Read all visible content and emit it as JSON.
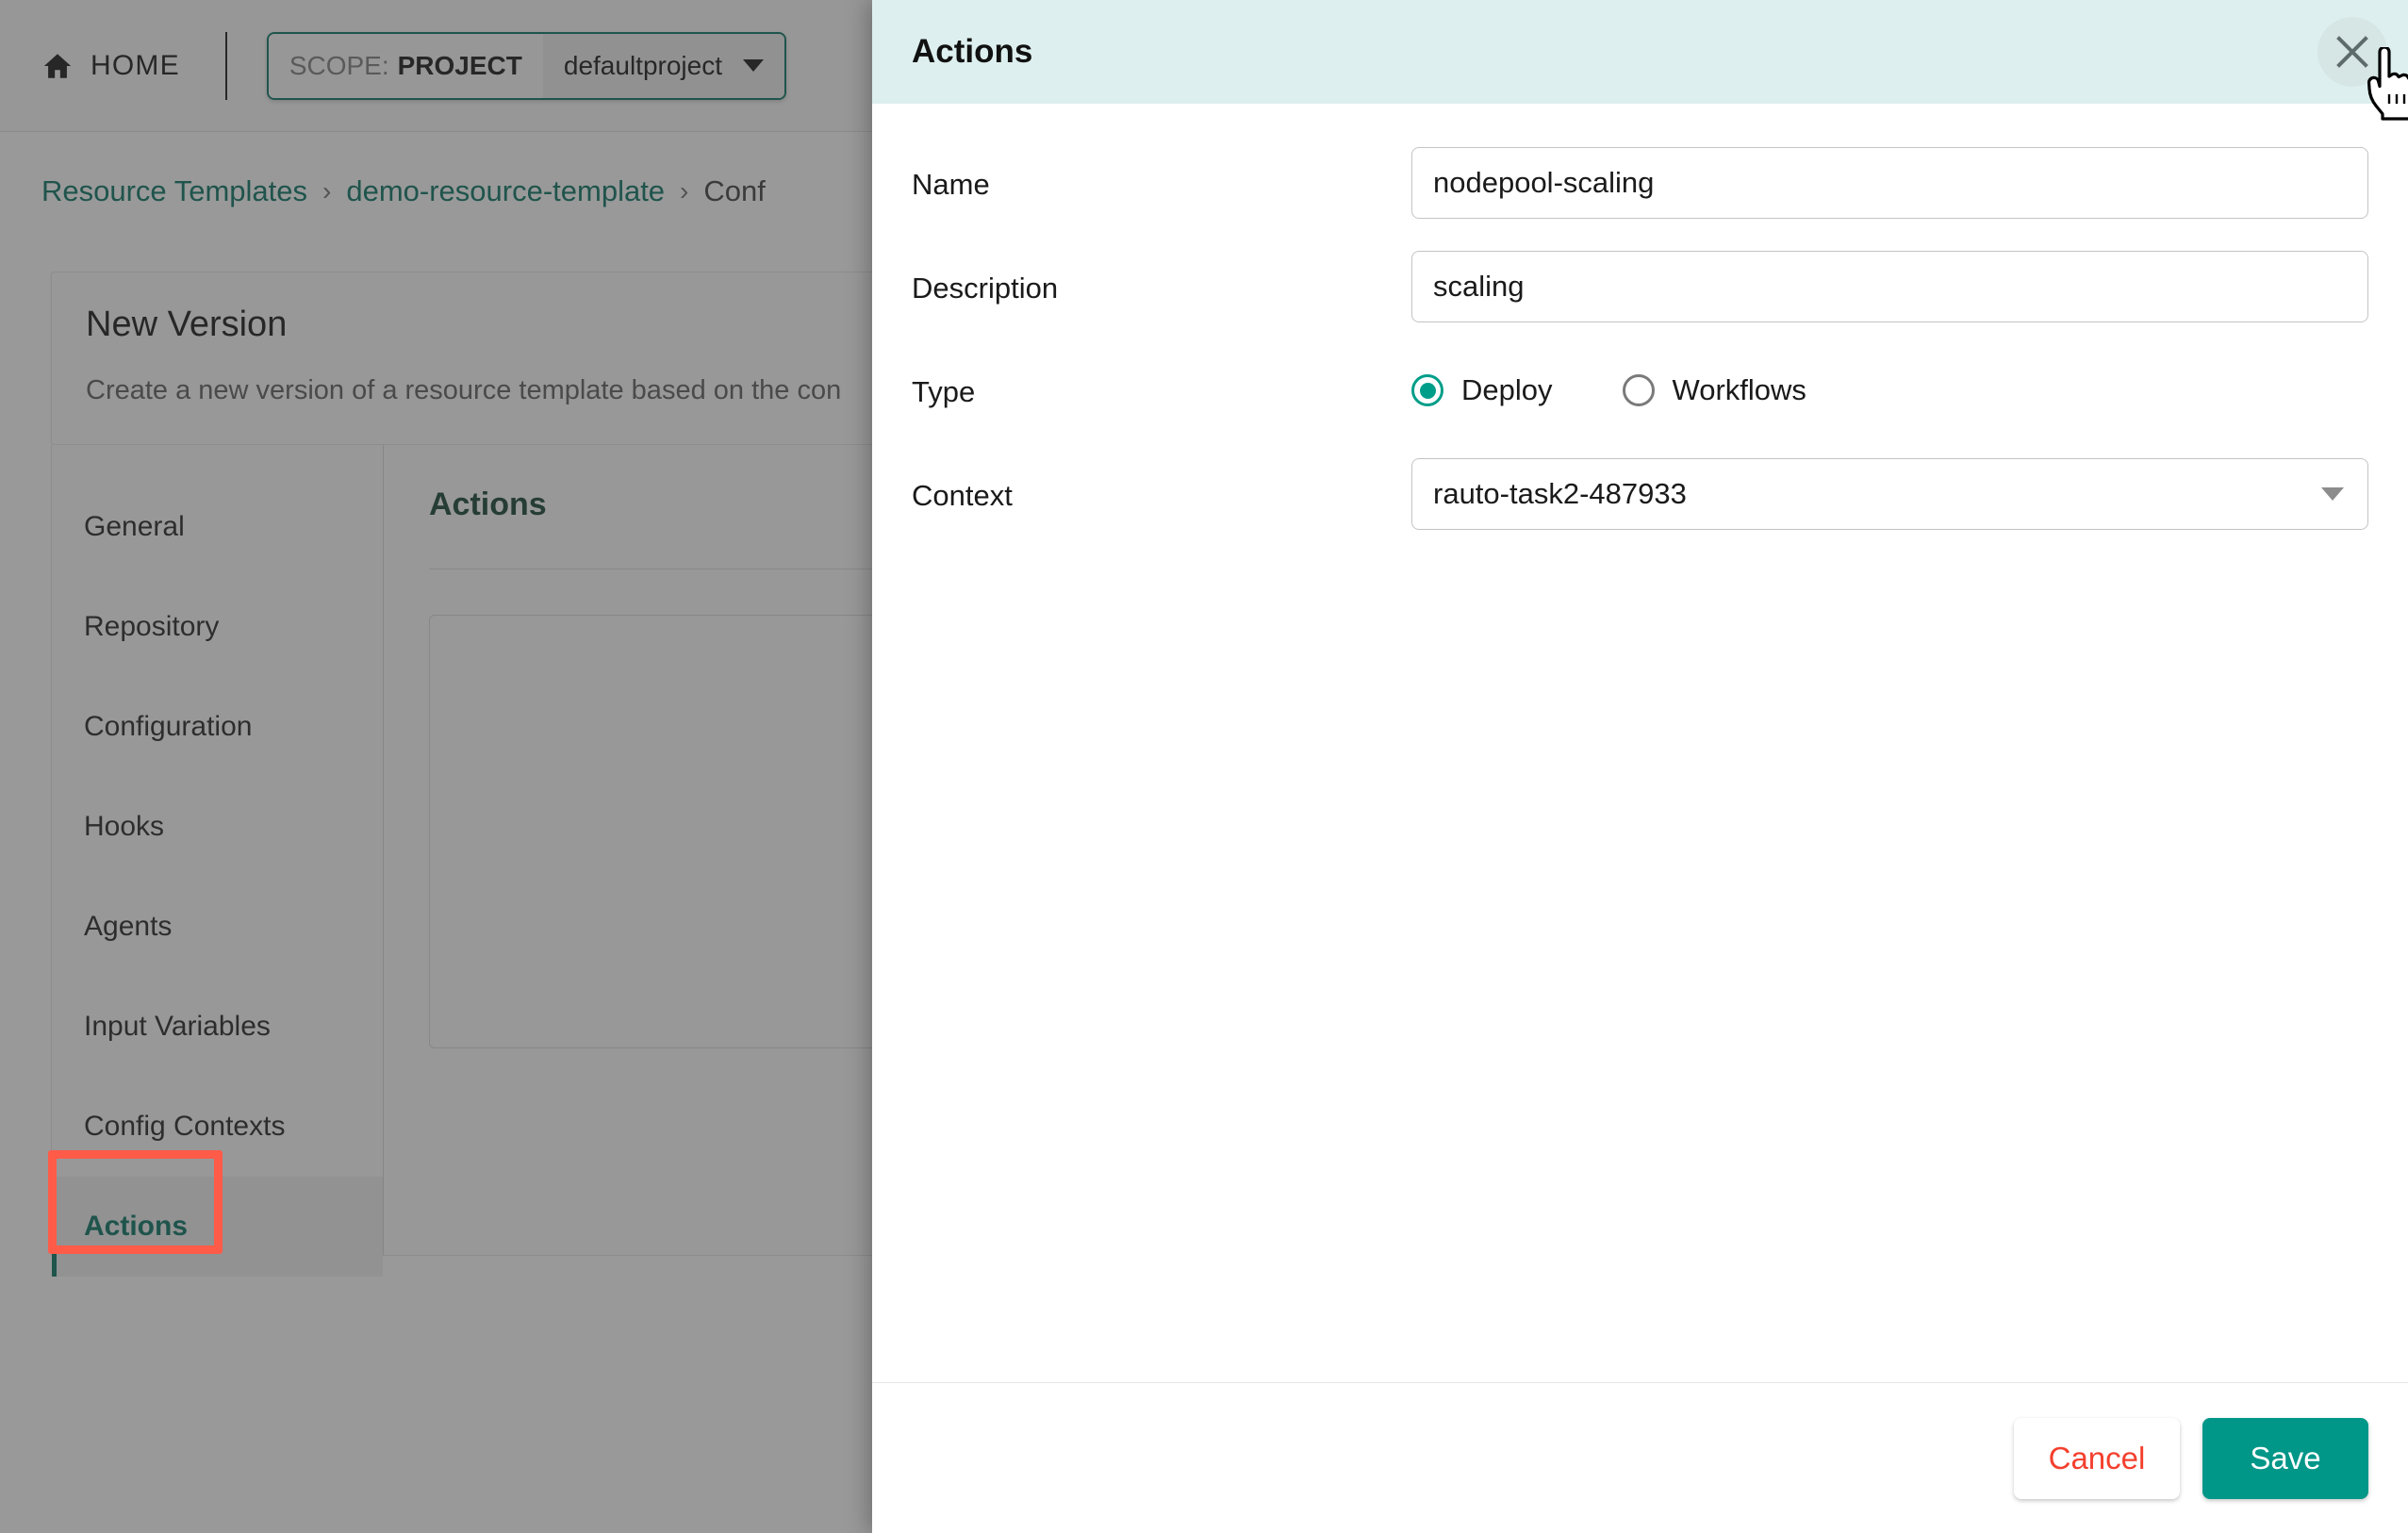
{
  "topbar": {
    "home_label": "HOME",
    "home_icon": "home-icon",
    "scope_key": "SCOPE:",
    "scope_value": "PROJECT",
    "project_name": "defaultproject",
    "project_caret_icon": "chevron-down-icon"
  },
  "breadcrumb": {
    "items": [
      {
        "label": "Resource Templates",
        "link": true
      },
      {
        "label": "demo-resource-template",
        "link": true
      },
      {
        "label": "Conf",
        "link": false
      }
    ],
    "separator": "›"
  },
  "page": {
    "title": "New Version",
    "subtitle": "Create a new version of a resource template based on the con"
  },
  "vnav": {
    "items": [
      {
        "label": "General",
        "active": false
      },
      {
        "label": "Repository",
        "active": false
      },
      {
        "label": "Configuration",
        "active": false
      },
      {
        "label": "Hooks",
        "active": false
      },
      {
        "label": "Agents",
        "active": false
      },
      {
        "label": "Input Variables",
        "active": false
      },
      {
        "label": "Config Contexts",
        "active": false
      },
      {
        "label": "Actions",
        "active": true
      }
    ]
  },
  "panel": {
    "title": "Actions"
  },
  "modal": {
    "title": "Actions",
    "close_icon": "close-icon",
    "fields": {
      "name_label": "Name",
      "name_value": "nodepool-scaling",
      "description_label": "Description",
      "description_value": "scaling",
      "type_label": "Type",
      "type_options": [
        {
          "label": "Deploy",
          "selected": true
        },
        {
          "label": "Workflows",
          "selected": false
        }
      ],
      "context_label": "Context",
      "context_value": "rauto-task2-487933",
      "context_caret_icon": "chevron-down-icon"
    },
    "footer": {
      "cancel_label": "Cancel",
      "save_label": "Save"
    }
  },
  "colors": {
    "brand_teal": "#00705e",
    "accent_teal": "#009688",
    "header_teal_bg": "#ddefee",
    "cancel_red": "#f4402e",
    "annotation_red": "#ff5b49",
    "panel_title_green": "#10402f"
  },
  "annotation": {
    "target": "Actions"
  },
  "cursor": {
    "icon": "pointing-hand-cursor"
  }
}
